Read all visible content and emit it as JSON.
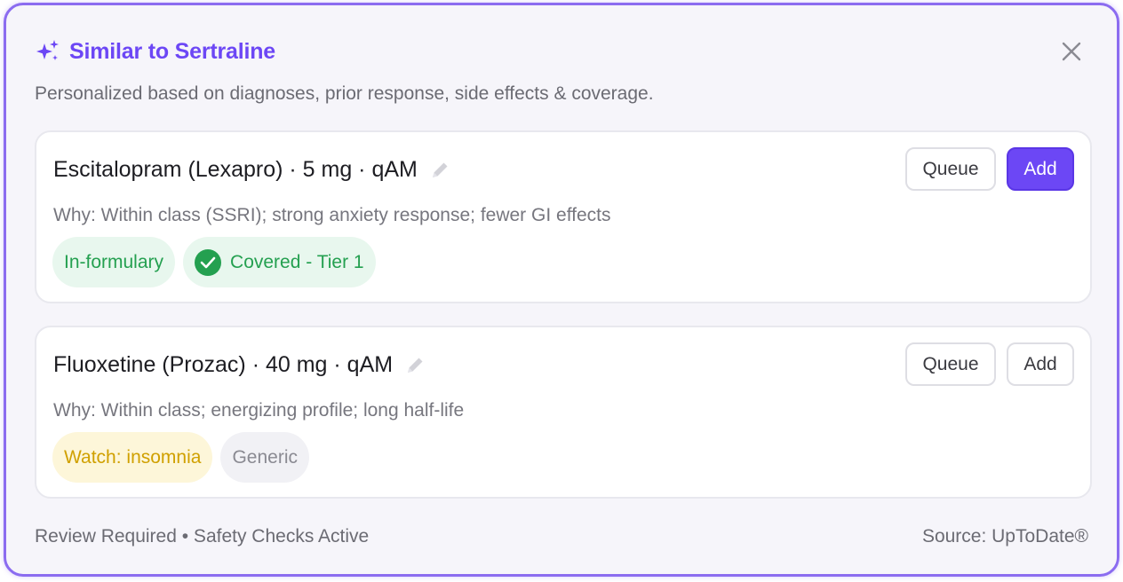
{
  "header": {
    "title": "Similar to Sertraline",
    "subtitle": "Personalized based on diagnoses, prior response, side effects & coverage."
  },
  "suggestions": [
    {
      "drug": "Escitalopram (Lexapro) · 5 mg · qAM",
      "why": "Why: Within class (SSRI); strong anxiety response; fewer GI effects",
      "tags": [
        "In-formulary",
        "Covered - Tier 1"
      ],
      "queue_label": "Queue",
      "add_label": "Add"
    },
    {
      "drug": "Fluoxetine (Prozac) · 40 mg · qAM",
      "why": "Why: Within class; energizing profile; long half-life",
      "tags": [
        "Watch: insomnia",
        "Generic"
      ],
      "queue_label": "Queue",
      "add_label": "Add"
    }
  ],
  "footer": {
    "status": "Review Required • Safety Checks Active",
    "source": "Source: UpToDate®"
  },
  "colors": {
    "accent": "#6c47f5",
    "success": "#24a050",
    "warning": "#d0a000"
  },
  "icons": {
    "header": "sparkles-icon",
    "close": "close-icon",
    "edit": "pencil-icon",
    "covered": "check-circle-icon"
  }
}
